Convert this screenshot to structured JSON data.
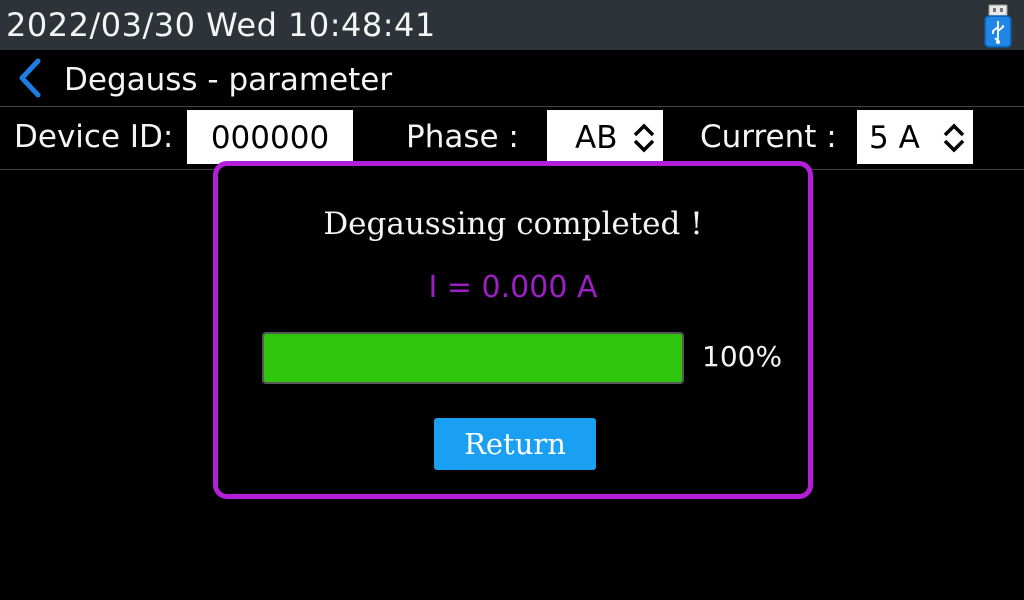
{
  "status": {
    "datetime": "2022/03/30 Wed 10:48:41",
    "icon": "usb-drive-icon"
  },
  "header": {
    "back_icon": "chevron-left-icon",
    "title": "Degauss - parameter"
  },
  "params": {
    "device_id_label": "Device ID:",
    "device_id_value": "000000",
    "phase_label": "Phase :",
    "phase_value": "AB",
    "current_label": "Current :",
    "current_value": "5 A"
  },
  "dialog": {
    "message": "Degaussing completed !",
    "current_reading": "I = 0.000 A",
    "progress_percent": 100,
    "progress_text": "100%",
    "return_label": "Return"
  },
  "colors": {
    "dialog_border": "#b31fd8",
    "progress_fill": "#2ec50c",
    "button": "#1aa0f3",
    "accent_back": "#1e7de0",
    "reading": "#9c1fc4"
  }
}
